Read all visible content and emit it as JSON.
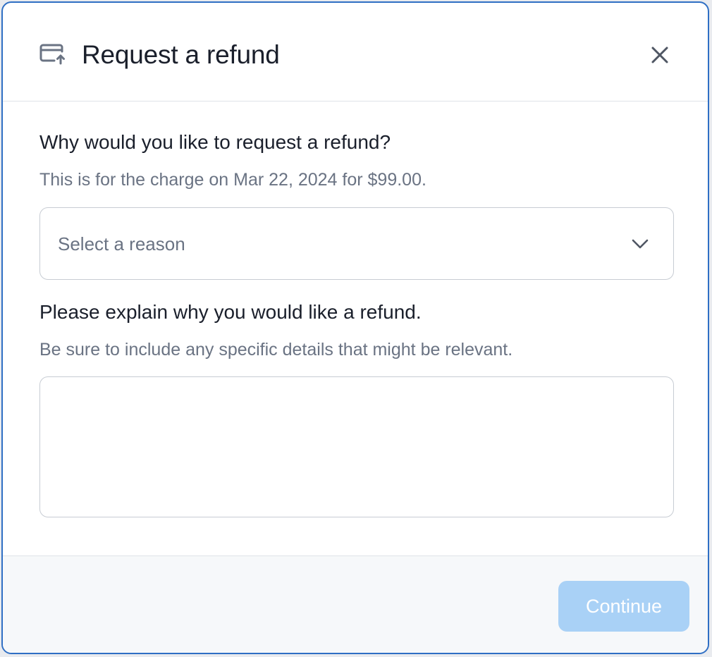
{
  "dialog": {
    "title": "Request a refund",
    "header_icon": "card-refund-icon",
    "close_icon": "close-icon"
  },
  "form": {
    "reason": {
      "label": "Why would you like to request a refund?",
      "hint": "This is for the charge on Mar 22, 2024 for $99.00.",
      "placeholder": "Select a reason",
      "selected_value": "",
      "icon": "chevron-down-icon"
    },
    "explanation": {
      "label": "Please explain why you would like a refund.",
      "hint": "Be sure to include any specific details that might be relevant.",
      "value": ""
    }
  },
  "footer": {
    "continue_label": "Continue",
    "continue_disabled": true
  },
  "colors": {
    "modal_border": "#2f6fc4",
    "text_primary": "#1a1f2b",
    "text_secondary": "#6a7383",
    "button_disabled_bg": "#a9d1f6",
    "footer_bg": "#f6f8fa"
  }
}
